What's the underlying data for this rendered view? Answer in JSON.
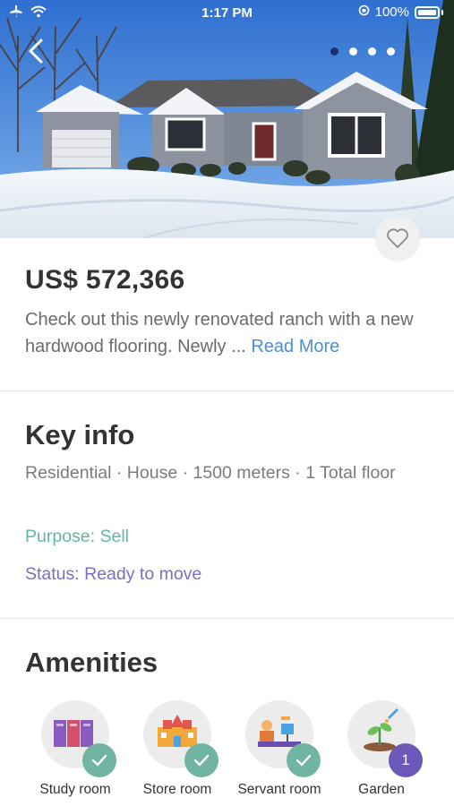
{
  "status_bar": {
    "time": "1:17 PM",
    "battery_percent": "100%",
    "icons": [
      "airplane-icon",
      "wifi-icon",
      "orientation-lock-icon",
      "battery-icon"
    ]
  },
  "gallery": {
    "image_count": 4,
    "active_index": 0
  },
  "listing": {
    "price": "US$ 572,366",
    "description": "Check out this newly renovated ranch with a new hardwood flooring. Newly ...",
    "read_more_label": "Read More"
  },
  "key_info": {
    "title": "Key info",
    "details": "Residential · House · 1500 meters · 1 Total floor",
    "purpose": "Purpose: Sell",
    "status": "Status: Ready to move"
  },
  "amenities": {
    "title": "Amenities",
    "items": [
      {
        "label": "Study room",
        "icon": "lockers-icon",
        "badge": "check"
      },
      {
        "label": "Store room",
        "icon": "building-icon",
        "badge": "check"
      },
      {
        "label": "Servant room",
        "icon": "worker-desk-icon",
        "badge": "check"
      },
      {
        "label": "Garden",
        "icon": "plant-icon",
        "badge": "1"
      }
    ]
  },
  "colors": {
    "accent_blue": "#4a8fd6",
    "purpose_green": "#62b7a4",
    "status_purple": "#7a6fc0",
    "check_badge": "#6fb5a1",
    "count_badge": "#6b58b8"
  }
}
